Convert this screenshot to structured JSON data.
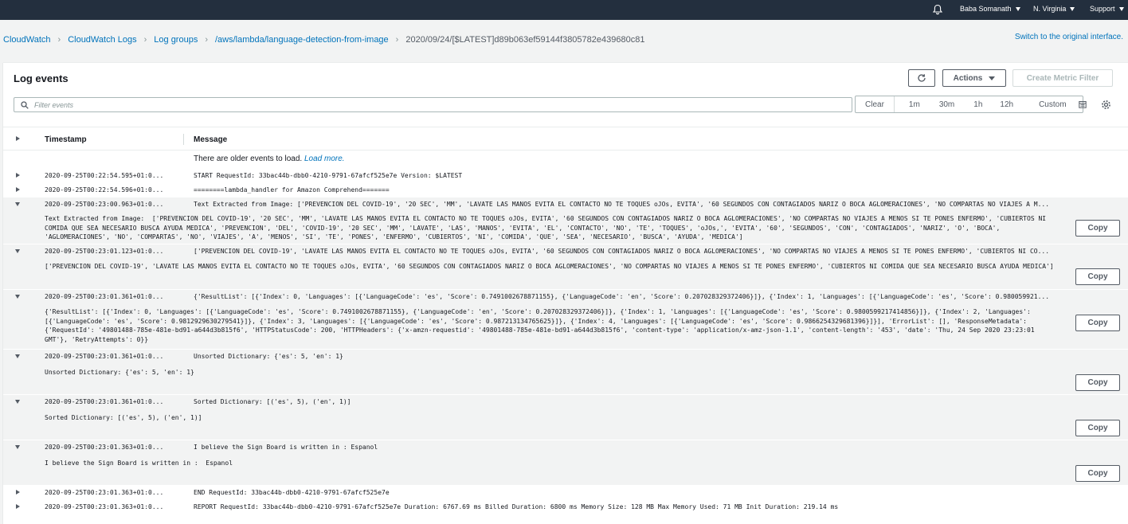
{
  "topbar": {
    "user": "Baba Somanath",
    "region": "N. Virginia",
    "support": "Support"
  },
  "breadcrumbs": [
    "CloudWatch",
    "CloudWatch Logs",
    "Log groups",
    "/aws/lambda/language-detection-from-image",
    "2020/09/24/[$LATEST]d89b063ef59144f3805782e439680c81"
  ],
  "switch_link": "Switch to the original interface.",
  "panel": {
    "title": "Log events",
    "actions_label": "Actions",
    "create_metric_label": "Create Metric Filter",
    "filter_placeholder": "Filter events",
    "time_options": [
      "Clear",
      "1m",
      "30m",
      "1h",
      "12h",
      "Custom"
    ]
  },
  "table": {
    "col_timestamp": "Timestamp",
    "col_message": "Message",
    "older_text": "There are older events to load.",
    "load_more": "Load more."
  },
  "copy_label": "Copy",
  "events": [
    {
      "ts": "2020-09-25T00:22:54.595+01:0...",
      "msg": "START RequestId: 33bac44b-dbb0-4210-9791-67afcf525e7e Version: $LATEST"
    },
    {
      "ts": "2020-09-25T00:22:54.596+01:0...",
      "msg": "========lambda_handler for Amazon Comprehend======="
    },
    {
      "ts": "2020-09-25T00:23:00.963+01:0...",
      "msg": "Text Extracted from Image: ['PREVENCION DEL COVID-19', '20 SEC', 'MM', 'LAVATE LAS MANOS EVITA EL CONTACTO NO TE TOQUES oJOs, EVITA', '60 SEGUNDOS CON CONTAGIADOS NARIZ O BOCA AGLOMERACIONES', 'NO COMPARTAS NO VIAJES A M...",
      "detail": "Text Extracted from Image:  ['PREVENCION DEL COVID-19', '20 SEC', 'MM', 'LAVATE LAS MANOS EVITA EL CONTACTO NO TE TOQUES oJOs, EVITA', '60 SEGUNDOS CON CONTAGIADOS NARIZ O BOCA AGLOMERACIONES', 'NO COMPARTAS NO VIAJES A MENOS SI TE PONES ENFERMO', 'CUBIERTOS NI COMIDA QUE SEA NECESARIO BUSCA AYUDA MEDICA', 'PREVENCION', 'DEL', 'COVID-19', '20 SEC', 'MM', 'LAVATE', 'LAS', 'MANOS', 'EVITA', 'EL', 'CONTACTO', 'NO', 'TE', 'TOQUES', 'oJOs,', 'EVITA', '60', 'SEGUNDOS', 'CON', 'CONTAGIADOS', 'NARIZ', 'O', 'BOCA', 'AGLOMERACIONES', 'NO', 'COMPARTAS', 'NO', 'VIAJES', 'A', 'MENOS', 'SI', 'TE', 'PONES', 'ENFERMO', 'CUBIERTOS', 'NI', 'COMIDA', 'QUE', 'SEA', 'NECESARIO', 'BUSCA', 'AYUDA', 'MEDICA']"
    },
    {
      "ts": "2020-09-25T00:23:01.123+01:0...",
      "msg": "['PREVENCION DEL COVID-19', 'LAVATE LAS MANOS EVITA EL CONTACTO NO TE TOQUES oJOs, EVITA', '60 SEGUNDOS CON CONTAGIADOS NARIZ O BOCA AGLOMERACIONES', 'NO COMPARTAS NO VIAJES A MENOS SI TE PONES ENFERMO', 'CUBIERTOS NI CO...",
      "detail": "['PREVENCION DEL COVID-19', 'LAVATE LAS MANOS EVITA EL CONTACTO NO TE TOQUES oJOs, EVITA', '60 SEGUNDOS CON CONTAGIADOS NARIZ O BOCA AGLOMERACIONES', 'NO COMPARTAS NO VIAJES A MENOS SI TE PONES ENFERMO', 'CUBIERTOS NI COMIDA QUE SEA NECESARIO BUSCA AYUDA MEDICA']"
    },
    {
      "ts": "2020-09-25T00:23:01.361+01:0...",
      "msg": "{'ResultList': [{'Index': 0, 'Languages': [{'LanguageCode': 'es', 'Score': 0.7491002678871155}, {'LanguageCode': 'en', 'Score': 0.207028329372406}]}, {'Index': 1, 'Languages': [{'LanguageCode': 'es', 'Score': 0.980059921...",
      "detail": "{'ResultList': [{'Index': 0, 'Languages': [{'LanguageCode': 'es', 'Score': 0.7491002678871155}, {'LanguageCode': 'en', 'Score': 0.207028329372406}]}, {'Index': 1, 'Languages': [{'LanguageCode': 'es', 'Score': 0.9800599217414856}]}, {'Index': 2, 'Languages': [{'LanguageCode': 'es', 'Score': 0.9812929630279541}]}, {'Index': 3, 'Languages': [{'LanguageCode': 'es', 'Score': 0.987213134765625}]}, {'Index': 4, 'Languages': [{'LanguageCode': 'es', 'Score': 0.9866254329681396}]}], 'ErrorList': [], 'ResponseMetadata': {'RequestId': '49801488-785e-481e-bd91-a644d3b815f6', 'HTTPStatusCode': 200, 'HTTPHeaders': {'x-amzn-requestid': '49801488-785e-481e-bd91-a644d3b815f6', 'content-type': 'application/x-amz-json-1.1', 'content-length': '453', 'date': 'Thu, 24 Sep 2020 23:23:01 GMT'}, 'RetryAttempts': 0}}"
    },
    {
      "ts": "2020-09-25T00:23:01.361+01:0...",
      "msg": "Unsorted Dictionary: {'es': 5, 'en': 1}",
      "detail": "Unsorted Dictionary: {'es': 5, 'en': 1}"
    },
    {
      "ts": "2020-09-25T00:23:01.361+01:0...",
      "msg": "Sorted Dictionary: [('es', 5), ('en', 1)]",
      "detail": "Sorted Dictionary: [('es', 5), ('en', 1)]"
    },
    {
      "ts": "2020-09-25T00:23:01.363+01:0...",
      "msg": "I believe the Sign Board is written in : Espanol",
      "detail": "I believe the Sign Board is written in :  Espanol"
    },
    {
      "ts": "2020-09-25T00:23:01.363+01:0...",
      "msg": "END RequestId: 33bac44b-dbb0-4210-9791-67afcf525e7e"
    },
    {
      "ts": "2020-09-25T00:23:01.363+01:0...",
      "msg": "REPORT RequestId: 33bac44b-dbb0-4210-9791-67afcf525e7e Duration: 6767.69 ms Billed Duration: 6800 ms Memory Size: 128 MB Max Memory Used: 71 MB Init Duration: 219.14 ms"
    }
  ]
}
